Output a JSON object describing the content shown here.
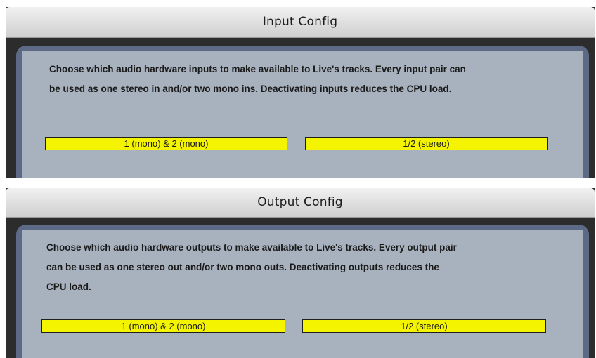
{
  "input_config": {
    "title": "Input Config",
    "message_line1": "Choose which audio hardware inputs to make available to Live's tracks. Every input pair can",
    "message_line2": "be used as one stereo in and/or two mono ins.  Deactivating inputs reduces the CPU load.",
    "toggles": [
      {
        "label": "1 (mono) & 2 (mono)",
        "active": true
      },
      {
        "label": "1/2 (stereo)",
        "active": true
      }
    ]
  },
  "output_config": {
    "title": "Output Config",
    "message_line1": "Choose which audio hardware outputs to make available to Live's tracks. Every output pair",
    "message_line2": "can be used as one stereo out and/or two mono outs.  Deactivating outputs reduces the",
    "message_line3": "CPU load.",
    "toggles": [
      {
        "label": "1 (mono) & 2 (mono)",
        "active": true
      },
      {
        "label": "1/2 (stereo)",
        "active": true
      }
    ]
  },
  "colors": {
    "toggle_active": "#f4f400",
    "panel_background": "#a8b1be",
    "panel_frame": "#5c6a86"
  }
}
